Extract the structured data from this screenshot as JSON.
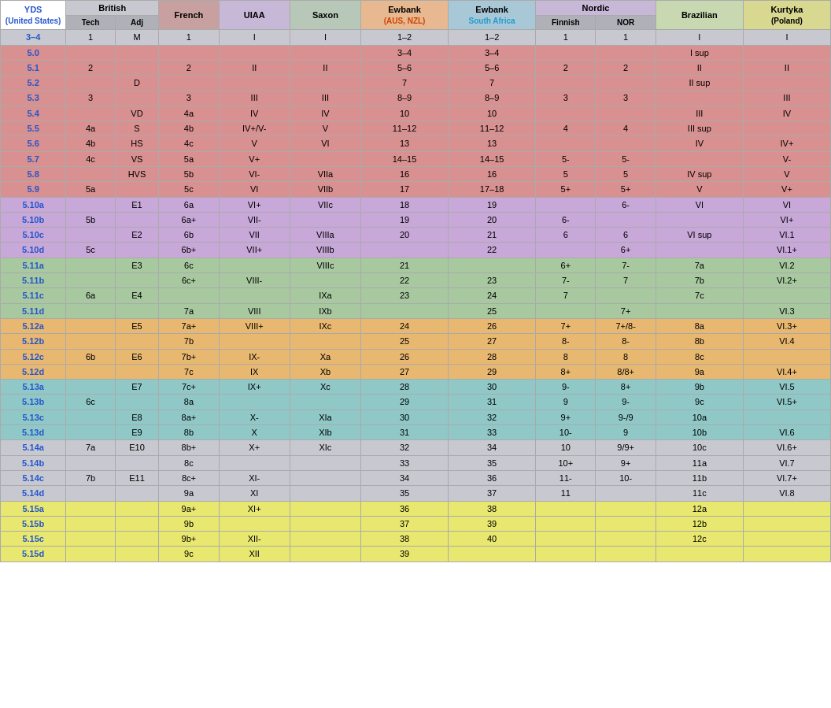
{
  "headers": {
    "yds": "YDS",
    "yds_sub": "(United States)",
    "british": "British",
    "brit_tech": "Tech",
    "brit_adj": "Adj",
    "french": "French",
    "uiaa": "UIAA",
    "saxon": "Saxon",
    "ewbank_aus": "Ewbank",
    "ewbank_aus_sub": "(AUS, NZL)",
    "ewbank_sa": "Ewbank",
    "ewbank_sa_sub": "South Africa",
    "nordic": "Nordic",
    "nordic_fin": "Finnish",
    "nordic_nor": "NOR",
    "brazilian": "Brazilian",
    "kurtyka": "Kurtyka",
    "kurtyka_sub": "(Poland)"
  },
  "rows": [
    {
      "c": "gray",
      "yds": "3–4",
      "bt": "1",
      "ba": "M",
      "fr": "1",
      "ui": "I",
      "sa": "I",
      "ea": "1–2",
      "es": "1–2",
      "nf": "1",
      "nn": "1",
      "br": "I",
      "ku": "I"
    },
    {
      "c": "red",
      "yds": "5.0",
      "bt": "",
      "ba": "",
      "fr": "",
      "ui": "",
      "sa": "",
      "ea": "3–4",
      "es": "3–4",
      "nf": "",
      "nn": "",
      "br": "I sup",
      "ku": ""
    },
    {
      "c": "red",
      "yds": "5.1",
      "bt": "2",
      "ba": "",
      "fr": "2",
      "ui": "II",
      "sa": "II",
      "ea": "5–6",
      "es": "5–6",
      "nf": "2",
      "nn": "2",
      "br": "II",
      "ku": "II"
    },
    {
      "c": "red",
      "yds": "5.2",
      "bt": "",
      "ba": "D",
      "fr": "",
      "ui": "",
      "sa": "",
      "ea": "7",
      "es": "7",
      "nf": "",
      "nn": "",
      "br": "II sup",
      "ku": ""
    },
    {
      "c": "red",
      "yds": "5.3",
      "bt": "3",
      "ba": "",
      "fr": "3",
      "ui": "III",
      "sa": "III",
      "ea": "8–9",
      "es": "8–9",
      "nf": "3",
      "nn": "3",
      "br": "",
      "ku": "III"
    },
    {
      "c": "red",
      "yds": "5.4",
      "bt": "",
      "ba": "VD",
      "fr": "4a",
      "ui": "IV",
      "sa": "IV",
      "ea": "10",
      "es": "10",
      "nf": "",
      "nn": "",
      "br": "III",
      "ku": "IV"
    },
    {
      "c": "red",
      "yds": "5.5",
      "bt": "4a",
      "ba": "S",
      "fr": "4b",
      "ui": "IV+/V-",
      "sa": "V",
      "ea": "11–12",
      "es": "11–12",
      "nf": "4",
      "nn": "4",
      "br": "III sup",
      "ku": ""
    },
    {
      "c": "red",
      "yds": "5.6",
      "bt": "4b",
      "ba": "HS",
      "fr": "4c",
      "ui": "V",
      "sa": "VI",
      "ea": "13",
      "es": "13",
      "nf": "",
      "nn": "",
      "br": "IV",
      "ku": "IV+"
    },
    {
      "c": "red",
      "yds": "5.7",
      "bt": "4c",
      "ba": "VS",
      "fr": "5a",
      "ui": "V+",
      "sa": "",
      "ea": "14–15",
      "es": "14–15",
      "nf": "5-",
      "nn": "5-",
      "br": "",
      "ku": "V-"
    },
    {
      "c": "red",
      "yds": "5.8",
      "bt": "",
      "ba": "HVS",
      "fr": "5b",
      "ui": "VI-",
      "sa": "VIIa",
      "ea": "16",
      "es": "16",
      "nf": "5",
      "nn": "5",
      "br": "IV sup",
      "ku": "V"
    },
    {
      "c": "red",
      "yds": "5.9",
      "bt": "5a",
      "ba": "",
      "fr": "5c",
      "ui": "VI",
      "sa": "VIIb",
      "ea": "17",
      "es": "17–18",
      "nf": "5+",
      "nn": "5+",
      "br": "V",
      "ku": "V+"
    },
    {
      "c": "purple",
      "yds": "5.10a",
      "bt": "",
      "ba": "E1",
      "fr": "6a",
      "ui": "VI+",
      "sa": "VIIc",
      "ea": "18",
      "es": "19",
      "nf": "",
      "nn": "6-",
      "br": "VI",
      "ku": "VI"
    },
    {
      "c": "purple",
      "yds": "5.10b",
      "bt": "5b",
      "ba": "",
      "fr": "6a+",
      "ui": "VII-",
      "sa": "",
      "ea": "19",
      "es": "20",
      "nf": "6-",
      "nn": "",
      "br": "",
      "ku": "VI+"
    },
    {
      "c": "purple",
      "yds": "5.10c",
      "bt": "",
      "ba": "E2",
      "fr": "6b",
      "ui": "VII",
      "sa": "VIIIa",
      "ea": "20",
      "es": "21",
      "nf": "6",
      "nn": "6",
      "br": "VI sup",
      "ku": "VI.1"
    },
    {
      "c": "purple",
      "yds": "5.10d",
      "bt": "5c",
      "ba": "",
      "fr": "6b+",
      "ui": "VII+",
      "sa": "VIIIb",
      "ea": "",
      "es": "22",
      "nf": "",
      "nn": "6+",
      "br": "",
      "ku": "VI.1+"
    },
    {
      "c": "green",
      "yds": "5.11a",
      "bt": "",
      "ba": "E3",
      "fr": "6c",
      "ui": "",
      "sa": "VIIIc",
      "ea": "21",
      "es": "",
      "nf": "6+",
      "nn": "7-",
      "br": "7a",
      "ku": "VI.2"
    },
    {
      "c": "green",
      "yds": "5.11b",
      "bt": "",
      "ba": "",
      "fr": "6c+",
      "ui": "VIII-",
      "sa": "",
      "ea": "22",
      "es": "23",
      "nf": "7-",
      "nn": "7",
      "br": "7b",
      "ku": "VI.2+"
    },
    {
      "c": "green",
      "yds": "5.11c",
      "bt": "6a",
      "ba": "E4",
      "fr": "",
      "ui": "",
      "sa": "IXa",
      "ea": "23",
      "es": "24",
      "nf": "7",
      "nn": "",
      "br": "7c",
      "ku": ""
    },
    {
      "c": "green",
      "yds": "5.11d",
      "bt": "",
      "ba": "",
      "fr": "7a",
      "ui": "VIII",
      "sa": "IXb",
      "ea": "",
      "es": "25",
      "nf": "",
      "nn": "7+",
      "br": "",
      "ku": "VI.3"
    },
    {
      "c": "orange",
      "yds": "5.12a",
      "bt": "",
      "ba": "E5",
      "fr": "7a+",
      "ui": "VIII+",
      "sa": "IXc",
      "ea": "24",
      "es": "26",
      "nf": "7+",
      "nn": "7+/8-",
      "br": "8a",
      "ku": "VI.3+"
    },
    {
      "c": "orange",
      "yds": "5.12b",
      "bt": "",
      "ba": "",
      "fr": "7b",
      "ui": "",
      "sa": "",
      "ea": "25",
      "es": "27",
      "nf": "8-",
      "nn": "8-",
      "br": "8b",
      "ku": "VI.4"
    },
    {
      "c": "orange",
      "yds": "5.12c",
      "bt": "6b",
      "ba": "E6",
      "fr": "7b+",
      "ui": "IX-",
      "sa": "Xa",
      "ea": "26",
      "es": "28",
      "nf": "8",
      "nn": "8",
      "br": "8c",
      "ku": ""
    },
    {
      "c": "orange",
      "yds": "5.12d",
      "bt": "",
      "ba": "",
      "fr": "7c",
      "ui": "IX",
      "sa": "Xb",
      "ea": "27",
      "es": "29",
      "nf": "8+",
      "nn": "8/8+",
      "br": "9a",
      "ku": "VI.4+"
    },
    {
      "c": "teal",
      "yds": "5.13a",
      "bt": "",
      "ba": "E7",
      "fr": "7c+",
      "ui": "IX+",
      "sa": "Xc",
      "ea": "28",
      "es": "30",
      "nf": "9-",
      "nn": "8+",
      "br": "9b",
      "ku": "VI.5"
    },
    {
      "c": "teal",
      "yds": "5.13b",
      "bt": "6c",
      "ba": "",
      "fr": "8a",
      "ui": "",
      "sa": "",
      "ea": "29",
      "es": "31",
      "nf": "9",
      "nn": "9-",
      "br": "9c",
      "ku": "VI.5+"
    },
    {
      "c": "teal",
      "yds": "5.13c",
      "bt": "",
      "ba": "E8",
      "fr": "8a+",
      "ui": "X-",
      "sa": "XIa",
      "ea": "30",
      "es": "32",
      "nf": "9+",
      "nn": "9-/9",
      "br": "10a",
      "ku": ""
    },
    {
      "c": "teal",
      "yds": "5.13d",
      "bt": "",
      "ba": "E9",
      "fr": "8b",
      "ui": "X",
      "sa": "XIb",
      "ea": "31",
      "es": "33",
      "nf": "10-",
      "nn": "9",
      "br": "10b",
      "ku": "VI.6"
    },
    {
      "c": "gray",
      "yds": "5.14a",
      "bt": "7a",
      "ba": "E10",
      "fr": "8b+",
      "ui": "X+",
      "sa": "XIc",
      "ea": "32",
      "es": "34",
      "nf": "10",
      "nn": "9/9+",
      "br": "10c",
      "ku": "VI.6+"
    },
    {
      "c": "gray",
      "yds": "5.14b",
      "bt": "",
      "ba": "",
      "fr": "8c",
      "ui": "",
      "sa": "",
      "ea": "33",
      "es": "35",
      "nf": "10+",
      "nn": "9+",
      "br": "11a",
      "ku": "VI.7"
    },
    {
      "c": "gray",
      "yds": "5.14c",
      "bt": "7b",
      "ba": "E11",
      "fr": "8c+",
      "ui": "XI-",
      "sa": "",
      "ea": "34",
      "es": "36",
      "nf": "11-",
      "nn": "10-",
      "br": "11b",
      "ku": "VI.7+"
    },
    {
      "c": "gray",
      "yds": "5.14d",
      "bt": "",
      "ba": "",
      "fr": "9a",
      "ui": "XI",
      "sa": "",
      "ea": "35",
      "es": "37",
      "nf": "11",
      "nn": "",
      "br": "11c",
      "ku": "VI.8"
    },
    {
      "c": "yellow",
      "yds": "5.15a",
      "bt": "",
      "ba": "",
      "fr": "9a+",
      "ui": "XI+",
      "sa": "",
      "ea": "36",
      "es": "38",
      "nf": "",
      "nn": "",
      "br": "12a",
      "ku": ""
    },
    {
      "c": "yellow",
      "yds": "5.15b",
      "bt": "",
      "ba": "",
      "fr": "9b",
      "ui": "",
      "sa": "",
      "ea": "37",
      "es": "39",
      "nf": "",
      "nn": "",
      "br": "12b",
      "ku": ""
    },
    {
      "c": "yellow",
      "yds": "5.15c",
      "bt": "",
      "ba": "",
      "fr": "9b+",
      "ui": "XII-",
      "sa": "",
      "ea": "38",
      "es": "40",
      "nf": "",
      "nn": "",
      "br": "12c",
      "ku": ""
    },
    {
      "c": "yellow",
      "yds": "5.15d",
      "bt": "",
      "ba": "",
      "fr": "9c",
      "ui": "XII",
      "sa": "",
      "ea": "39",
      "es": "",
      "nf": "",
      "nn": "",
      "br": "",
      "ku": ""
    }
  ]
}
